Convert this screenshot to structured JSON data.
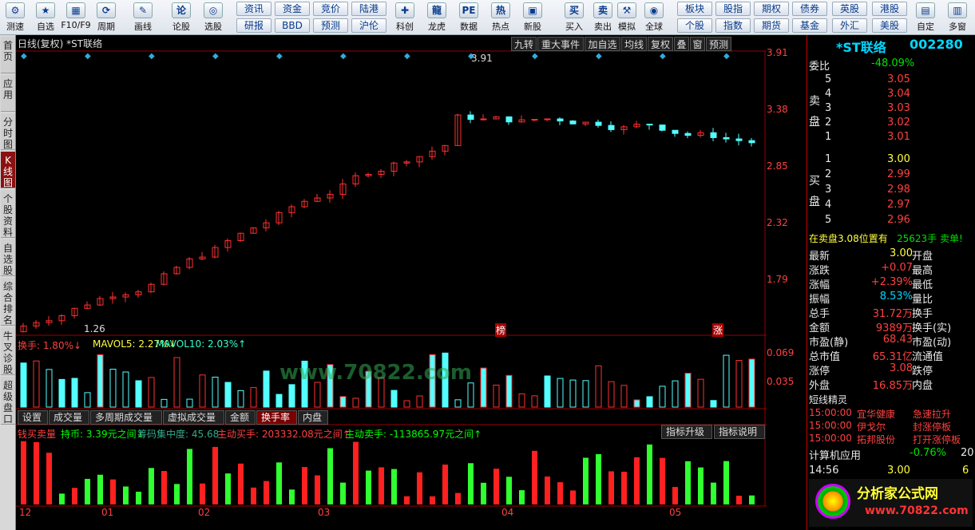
{
  "toolbar": {
    "items": [
      "测速",
      "自选",
      "F10/F9",
      "周期",
      "画线",
      "论股",
      "选股",
      "科创",
      "龙虎",
      "数据",
      "热点",
      "新股",
      "买入",
      "卖出",
      "模拟",
      "全球",
      "自定",
      "多窗"
    ],
    "buttons": [
      "资讯",
      "资金",
      "竞价",
      "陆港",
      "研报",
      "BBD",
      "预测",
      "沪伦",
      "板块",
      "股指",
      "期权",
      "债券",
      "英股",
      "港股",
      "个股",
      "指数",
      "期货",
      "基金",
      "外汇",
      "美股"
    ]
  },
  "sidebar": [
    "首页",
    "应用",
    "分时图",
    "K线图",
    "个股资料",
    "自选股",
    "综合排名",
    "牛叉诊股",
    "超级盘口"
  ],
  "chart": {
    "title": "日线(复权) *ST联络",
    "top_buttons": [
      "九转",
      "重大事件",
      "加自选",
      "均线",
      "复权",
      "叠",
      "窗",
      "预测"
    ],
    "price_axis": [
      "3.91",
      "3.38",
      "2.85",
      "2.32",
      "1.79"
    ],
    "high_label": "3.91",
    "low_label": "1.26",
    "tag1": "榜",
    "tag2": "涨",
    "vol_header": {
      "a": "换手: 1.80%↓",
      "b": "MAVOL5: 2.27%↓",
      "c": "MAVOL10: 2.03%↑"
    },
    "vol_axis": [
      "0.069",
      "0.035"
    ],
    "tabs": [
      "设置",
      "成交量",
      "多周期成交量",
      "虚拟成交量",
      "金额",
      "换手率",
      "内盘"
    ],
    "ind_header": {
      "a": "钱买卖量",
      "b": "持币: 3.39元之间↓",
      "c": "筹码集中度: 45.68",
      "d": "主动买手: 203332.08元之间↑",
      "e": "主动卖手: -113865.97元之间↑"
    },
    "ind_buttons": [
      "指标升级",
      "指标说明"
    ],
    "months": [
      "12",
      "01",
      "02",
      "03",
      "04",
      "05"
    ],
    "watermark": "www.70822.com"
  },
  "quote": {
    "name": "*ST联络",
    "code": "002280",
    "weibi_label": "委比",
    "weibi": "-48.09%",
    "sell": [
      [
        "5",
        "3.05"
      ],
      [
        "4",
        "3.04"
      ],
      [
        "3",
        "3.03"
      ],
      [
        "2",
        "3.02"
      ],
      [
        "1",
        "3.01"
      ]
    ],
    "buy": [
      [
        "1",
        "3.00"
      ],
      [
        "2",
        "2.99"
      ],
      [
        "3",
        "2.98"
      ],
      [
        "4",
        "2.97"
      ],
      [
        "5",
        "2.96"
      ]
    ],
    "sell_label": "卖盘",
    "buy_label": "买盘",
    "notice": "在卖盘3.08位置有",
    "notice2": "25623手 卖单!",
    "stats": [
      [
        "最新",
        "3.00",
        "开盘"
      ],
      [
        "涨跌",
        "+0.07",
        "最高"
      ],
      [
        "涨幅",
        "+2.39%",
        "最低"
      ],
      [
        "振幅",
        "8.53%",
        "量比"
      ],
      [
        "总手",
        "31.72万",
        "换手"
      ],
      [
        "金额",
        "9389万",
        "换手(实)"
      ],
      [
        "市盈(静)",
        "68.43",
        "市盈(动)"
      ],
      [
        "总市值",
        "65.31亿",
        "流通值"
      ],
      [
        "涨停",
        "3.08",
        "跌停"
      ],
      [
        "外盘",
        "16.85万",
        "内盘"
      ]
    ],
    "short_title": "短线精灵",
    "short": [
      [
        "15:00:00",
        "宜华健康",
        "急速拉升"
      ],
      [
        "15:00:00",
        "伊戈尔",
        "封涨停板"
      ],
      [
        "15:00:00",
        "拓邦股份",
        "打开涨停板"
      ]
    ],
    "sector": "计算机应用",
    "sector_pct": "-0.76%",
    "sector_num": "20",
    "tick_time": "14:56",
    "tick_price": "3.00",
    "tick_vol": "6",
    "logo": "分析家公式网",
    "logo_url": "www.70822.com"
  }
}
